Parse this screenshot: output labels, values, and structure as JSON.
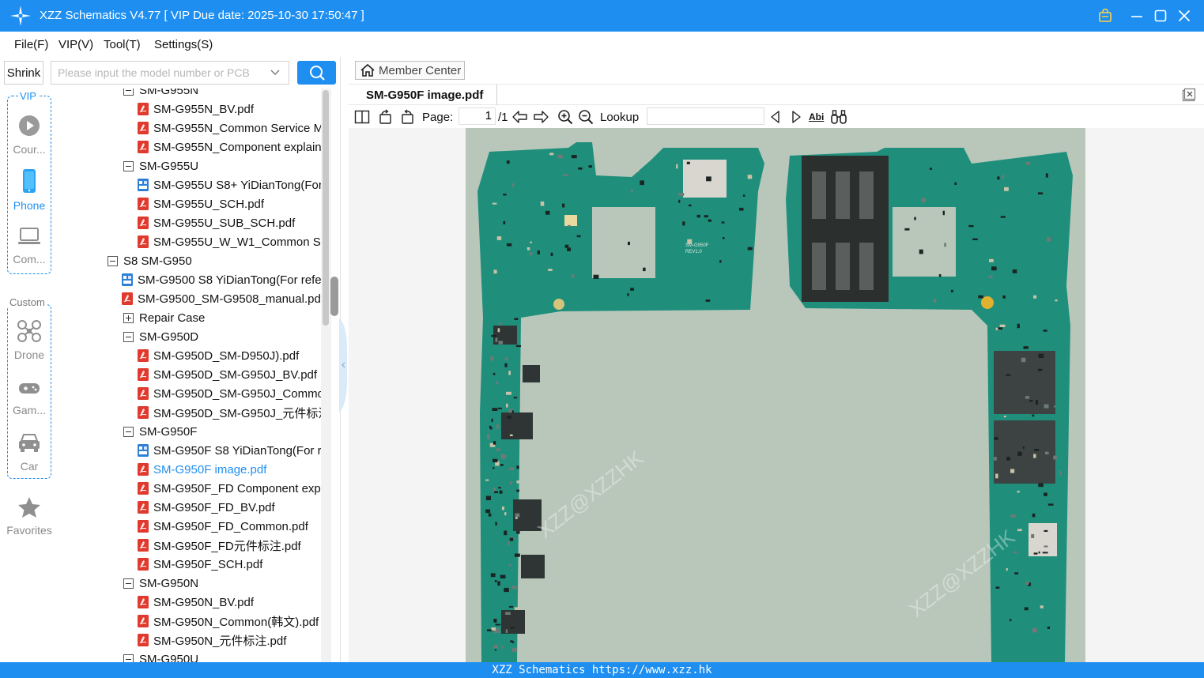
{
  "window": {
    "title": "XZZ Schematics V4.77 [ VIP Due date: 2025-10-30 17:50:47 ]"
  },
  "menu": [
    "File(F)",
    "VIP(V)",
    "Tool(T)",
    "Settings(S)"
  ],
  "sidebar": {
    "shrink_label": "Shrink",
    "search_placeholder": "Please input the model number or PCB",
    "vip_group_label": "VIP",
    "custom_group_label": "Custom",
    "vip_items": [
      {
        "label": "Cour...",
        "icon": "play-circle-icon",
        "active": false
      },
      {
        "label": "Phone",
        "icon": "phone-icon",
        "active": true
      },
      {
        "label": "Com...",
        "icon": "laptop-icon",
        "active": false
      }
    ],
    "custom_items": [
      {
        "label": "Drone",
        "icon": "drone-icon"
      },
      {
        "label": "Gam...",
        "icon": "gamepad-icon"
      },
      {
        "label": "Car",
        "icon": "car-icon"
      }
    ],
    "favorites_label": "Favorites"
  },
  "tree": {
    "rows": [
      {
        "label": "SM-G955N",
        "kind": "folder-open",
        "level": 2
      },
      {
        "label": "SM-G955N_BV.pdf",
        "kind": "pdf",
        "level": 3
      },
      {
        "label": "SM-G955N_Common Service M",
        "kind": "pdf",
        "level": 3
      },
      {
        "label": "SM-G955N_Component explain",
        "kind": "pdf",
        "level": 3
      },
      {
        "label": "SM-G955U",
        "kind": "folder-open",
        "level": 2
      },
      {
        "label": "SM-G955U S8+ YiDianTong(For",
        "kind": "ydt",
        "level": 3
      },
      {
        "label": "SM-G955U_SCH.pdf",
        "kind": "pdf",
        "level": 3
      },
      {
        "label": "SM-G955U_SUB_SCH.pdf",
        "kind": "pdf",
        "level": 3
      },
      {
        "label": "SM-G955U_W_W1_Common Ser",
        "kind": "pdf",
        "level": 3
      },
      {
        "label": "S8 SM-G950",
        "kind": "folder-open",
        "level": 1
      },
      {
        "label": "SM-G9500 S8 YiDianTong(For refe",
        "kind": "ydt",
        "level": 2
      },
      {
        "label": "SM-G9500_SM-G9508_manual.pdf",
        "kind": "pdf",
        "level": 2
      },
      {
        "label": "Repair Case",
        "kind": "folder-closed",
        "level": 2
      },
      {
        "label": "SM-G950D",
        "kind": "folder-open",
        "level": 2
      },
      {
        "label": "SM-G950D_SM-D950J).pdf",
        "kind": "pdf",
        "level": 3
      },
      {
        "label": "SM-G950D_SM-G950J_BV.pdf",
        "kind": "pdf",
        "level": 3
      },
      {
        "label": "SM-G950D_SM-G950J_Commor",
        "kind": "pdf",
        "level": 3
      },
      {
        "label": "SM-G950D_SM-G950J_元件标注.",
        "kind": "pdf",
        "level": 3
      },
      {
        "label": "SM-G950F",
        "kind": "folder-open",
        "level": 2
      },
      {
        "label": "SM-G950F S8 YiDianTong(For re",
        "kind": "ydt",
        "level": 3
      },
      {
        "label": "SM-G950F image.pdf",
        "kind": "pdf",
        "level": 3,
        "selected": true
      },
      {
        "label": "SM-G950F_FD Component expl",
        "kind": "pdf",
        "level": 3
      },
      {
        "label": "SM-G950F_FD_BV.pdf",
        "kind": "pdf",
        "level": 3
      },
      {
        "label": "SM-G950F_FD_Common.pdf",
        "kind": "pdf",
        "level": 3
      },
      {
        "label": "SM-G950F_FD元件标注.pdf",
        "kind": "pdf",
        "level": 3
      },
      {
        "label": "SM-G950F_SCH.pdf",
        "kind": "pdf",
        "level": 3
      },
      {
        "label": "SM-G950N",
        "kind": "folder-open",
        "level": 2
      },
      {
        "label": "SM-G950N_BV.pdf",
        "kind": "pdf",
        "level": 3
      },
      {
        "label": "SM-G950N_Common(韩文).pdf",
        "kind": "pdf",
        "level": 3
      },
      {
        "label": "SM-G950N_元件标注.pdf",
        "kind": "pdf",
        "level": 3
      },
      {
        "label": "SM-G950U",
        "kind": "folder-open",
        "level": 2
      }
    ]
  },
  "viewer": {
    "member_center_label": "Member Center",
    "doc_tab_title": "SM-G950F image.pdf",
    "page_label": "Page:",
    "page_current": "1",
    "page_total": "/1",
    "lookup_label": "Lookup",
    "lookup_value": "",
    "abc_label": "Abi",
    "board_labels": [
      "SM-G950F",
      "REV1.0",
      "SM-G950F",
      "REV1.0"
    ],
    "watermark": "XZZ@XZZHK"
  },
  "statusbar": {
    "text": "XZZ Schematics https://www.xzz.hk"
  },
  "colors": {
    "accent": "#1e8ff1",
    "pcb_green": "#1f8f7c",
    "pcb_bg": "#b9c7bb",
    "pdf_red": "#e03a2f"
  }
}
